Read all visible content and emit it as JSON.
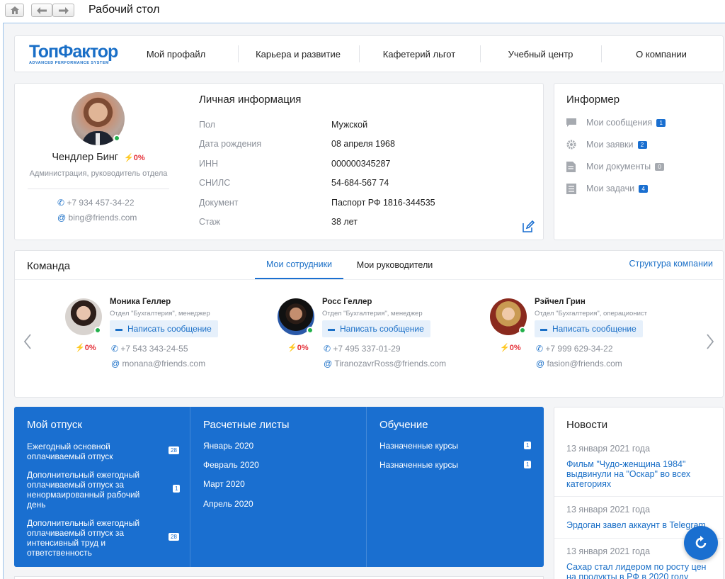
{
  "app": {
    "title": "Рабочий стол"
  },
  "logo": {
    "main": "ТопФактор",
    "sub": "ADVANCED PERFORMANCE SYSTEM"
  },
  "nav": {
    "items": [
      "Мой профайл",
      "Карьера и развитие",
      "Кафетерий льгот",
      "Учебный центр",
      "О компании"
    ]
  },
  "profile": {
    "name": "Чендлер Бинг",
    "pct": "0%",
    "position": "Администрация, руководитель отдела",
    "phone": "+7 934 457-34-22",
    "email": "bing@friends.com"
  },
  "personal_info": {
    "title": "Личная информация",
    "rows": [
      {
        "label": "Пол",
        "value": "Мужской"
      },
      {
        "label": "Дата рождения",
        "value": "08 апреля 1968"
      },
      {
        "label": "ИНН",
        "value": "000000345287"
      },
      {
        "label": "СНИЛС",
        "value": "54-684-567 74"
      },
      {
        "label": "Документ",
        "value": "Паспорт РФ 1816-344535"
      },
      {
        "label": "Стаж",
        "value": "38 лет"
      }
    ]
  },
  "informer": {
    "title": "Информер",
    "items": [
      {
        "label": "Мои сообщения",
        "count": "1",
        "color": "#1a6fd0"
      },
      {
        "label": "Мои заявки",
        "count": "2",
        "color": "#1a6fd0"
      },
      {
        "label": "Мои документы",
        "count": "0",
        "color": "#a6aab0"
      },
      {
        "label": "Мои задачи",
        "count": "4",
        "color": "#1a6fd0"
      }
    ]
  },
  "team": {
    "title": "Команда",
    "tabs": [
      "Мои сотрудники",
      "Мои руководители"
    ],
    "structure_link": "Структура компании",
    "message_label": "Написать сообщение",
    "members": [
      {
        "name": "Моника Геллер",
        "role": "Отдел \"Бухгалтерия\", менеджер",
        "pct": "0%",
        "phone": "+7 543 343-24-55",
        "email": "monana@friends.com"
      },
      {
        "name": "Росс Геллер",
        "role": "Отдел \"Бухгалтерия\", менеджер",
        "pct": "0%",
        "phone": "+7 495 337-01-29",
        "email": "TiranozavrRoss@friends.com"
      },
      {
        "name": "Рэйчел Грин",
        "role": "Отдел \"Бухгалтерия\", операционист",
        "pct": "0%",
        "phone": "+7 999 629-34-22",
        "email": "fasion@friends.com"
      }
    ]
  },
  "vacation": {
    "title": "Мой отпуск",
    "items": [
      {
        "text": "Ежегодный основной оплачиваемый отпуск",
        "count": "28"
      },
      {
        "text": "Дополнительный ежегодный оплачиваемый отпуск за ненормаированный рабочий день",
        "count": "1"
      },
      {
        "text": "Дополнительный ежегодный оплачиваемый отпуск за интенсивный труд и ответственность",
        "count": "28"
      }
    ]
  },
  "payslips": {
    "title": "Расчетные листы",
    "items": [
      "Январь 2020",
      "Февраль 2020",
      "Март 2020",
      "Апрель 2020"
    ]
  },
  "training": {
    "title": "Обучение",
    "items": [
      {
        "text": "Назначенные курсы",
        "count": "1"
      },
      {
        "text": "Назначенные курсы",
        "count": "1"
      }
    ]
  },
  "news": {
    "title": "Новости",
    "items": [
      {
        "date": "13 января 2021 года",
        "text": "Фильм \"Чудо-женщина 1984\" выдвинули на \"Оскар\" во всех категориях"
      },
      {
        "date": "13 января 2021 года",
        "text": "Эрдоган завел аккаунт в Telegram"
      },
      {
        "date": "13 января 2021 года",
        "text": "Сахар стал лидером по росту цен на продукты в РФ в 2020 году"
      }
    ]
  }
}
